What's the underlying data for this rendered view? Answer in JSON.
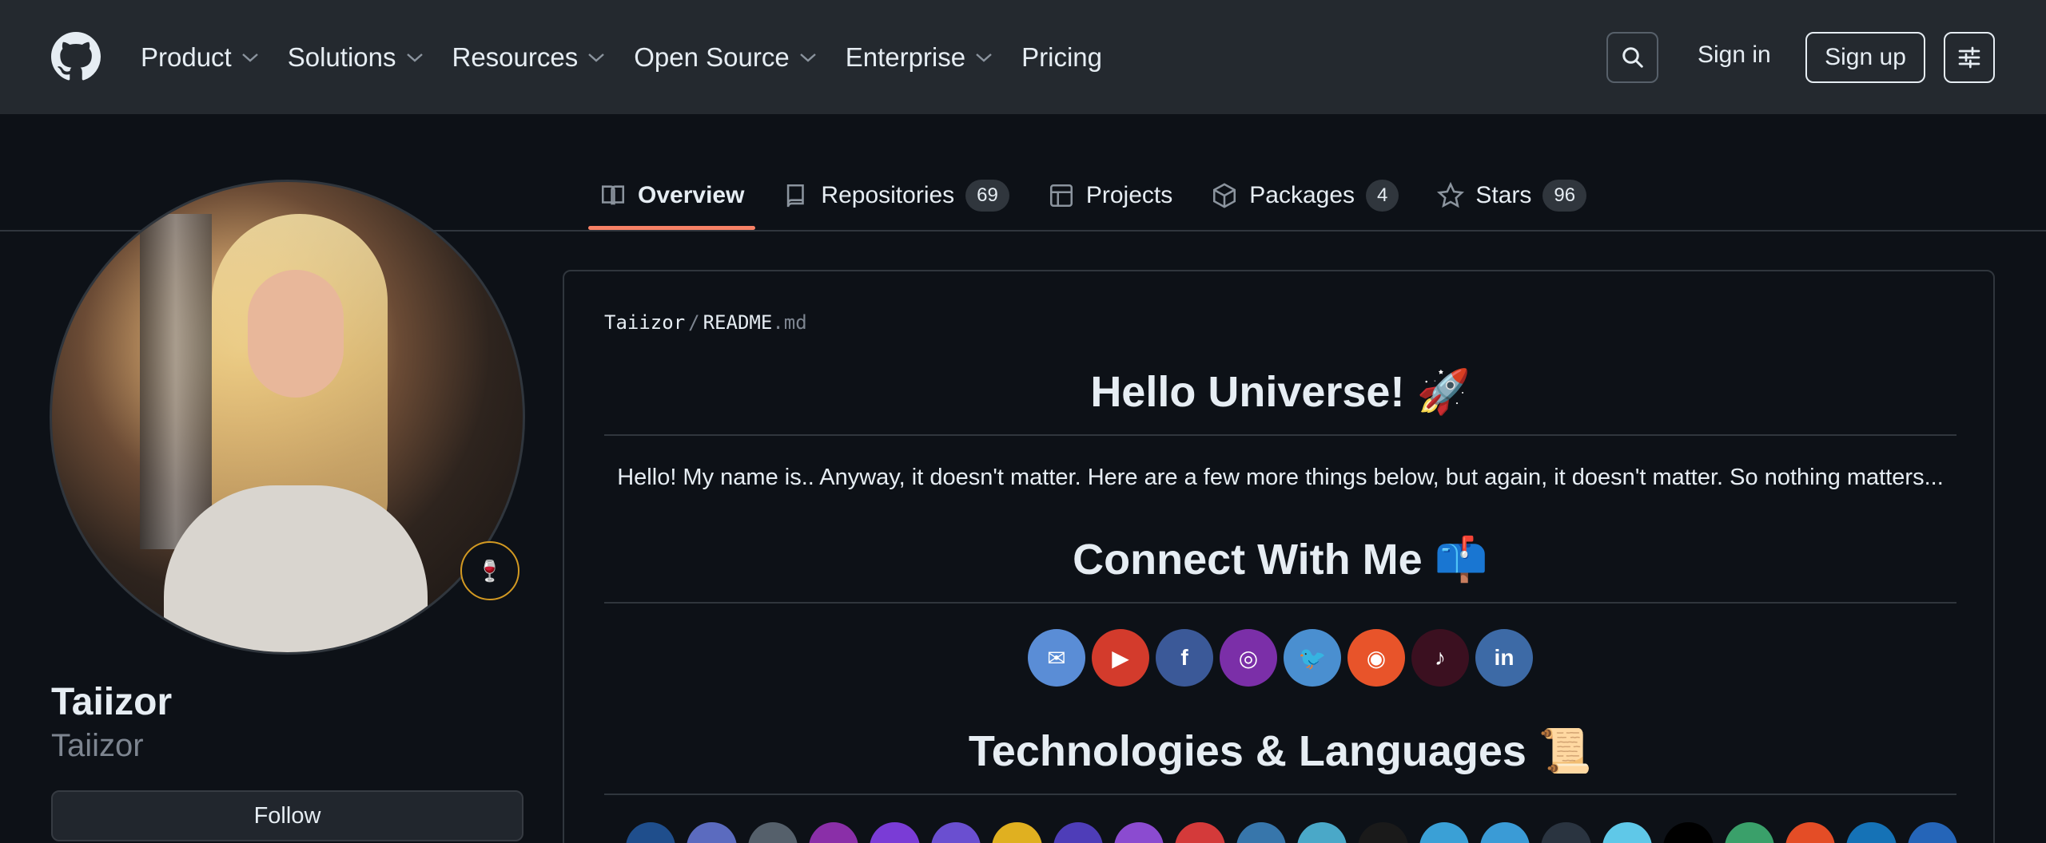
{
  "header": {
    "nav": [
      {
        "label": "Product",
        "dropdown": true
      },
      {
        "label": "Solutions",
        "dropdown": true
      },
      {
        "label": "Resources",
        "dropdown": true
      },
      {
        "label": "Open Source",
        "dropdown": true
      },
      {
        "label": "Enterprise",
        "dropdown": true
      },
      {
        "label": "Pricing",
        "dropdown": false
      }
    ],
    "sign_in": "Sign in",
    "sign_up": "Sign up"
  },
  "tabs": [
    {
      "label": "Overview",
      "icon": "book-icon",
      "active": true
    },
    {
      "label": "Repositories",
      "icon": "repo-icon",
      "count": "69"
    },
    {
      "label": "Projects",
      "icon": "table-icon"
    },
    {
      "label": "Packages",
      "icon": "package-icon",
      "count": "4"
    },
    {
      "label": "Stars",
      "icon": "star-icon",
      "count": "96"
    }
  ],
  "profile": {
    "name": "Taiizor",
    "login": "Taiizor",
    "status_emoji": "🍷",
    "follow_label": "Follow"
  },
  "readme": {
    "owner": "Taiizor",
    "separator": "/",
    "file": "README",
    "ext": ".md",
    "title": "Hello Universe! 🚀",
    "intro": "Hello! My name is.. Anyway, it doesn't matter. Here are a few more things below, but again, it doesn't matter. So nothing matters...",
    "connect_title": "Connect With Me 📫",
    "tech_title": "Technologies & Languages 📜",
    "social_icons": [
      {
        "name": "email-icon",
        "color": "#5a8dd6",
        "glyph": "✉"
      },
      {
        "name": "youtube-icon",
        "color": "#d33b2c",
        "glyph": "▶"
      },
      {
        "name": "facebook-icon",
        "color": "#3b5998",
        "glyph": "f"
      },
      {
        "name": "instagram-icon",
        "color": "#7b2fa8",
        "glyph": "◎"
      },
      {
        "name": "twitter-icon",
        "color": "#4a8fd0",
        "glyph": "🐦"
      },
      {
        "name": "reddit-icon",
        "color": "#e8542a",
        "glyph": "◉"
      },
      {
        "name": "tiktok-icon",
        "color": "#3b1020",
        "glyph": "♪"
      },
      {
        "name": "linkedin-icon",
        "color": "#3d6aa6",
        "glyph": "in"
      }
    ],
    "tech_colors": [
      "#1f4e8c",
      "#5b6bbf",
      "#55606b",
      "#8a2fa8",
      "#7a3cd6",
      "#6a4fd0",
      "#e0b020",
      "#4e3db8",
      "#8b4bd0",
      "#d43a3a",
      "#3776ab",
      "#4aa8c8",
      "#1a1a1a",
      "#3aa0d6",
      "#3a9bd6",
      "#2a3440",
      "#5fc8e8",
      "#000000",
      "#3aa06a",
      "#e44d26",
      "#1572b6",
      "#2565b8"
    ]
  }
}
